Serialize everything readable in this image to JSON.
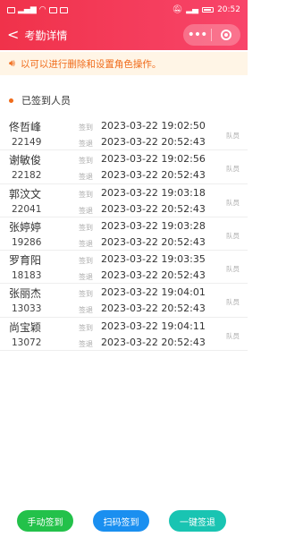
{
  "status_bar": {
    "time": "20:52"
  },
  "navbar": {
    "back_symbol": "<",
    "title": "考勤详情"
  },
  "notice": {
    "icon": "speaker-icon",
    "text": "以可以进行删除和设置角色操作。"
  },
  "section": {
    "title": "已签到人员"
  },
  "labels": {
    "sign_in": "签到",
    "sign_out": "签退"
  },
  "records": [
    {
      "name": "佟哲峰",
      "id": "22149",
      "sign_in": "2023-03-22 19:02:50",
      "sign_out": "2023-03-22 20:52:43",
      "role": "队员"
    },
    {
      "name": "谢敏俊",
      "id": "22182",
      "sign_in": "2023-03-22 19:02:56",
      "sign_out": "2023-03-22 20:52:43",
      "role": "队员"
    },
    {
      "name": "郭汶文",
      "id": "22041",
      "sign_in": "2023-03-22 19:03:18",
      "sign_out": "2023-03-22 20:52:43",
      "role": "队员"
    },
    {
      "name": "张婷婷",
      "id": "19286",
      "sign_in": "2023-03-22 19:03:28",
      "sign_out": "2023-03-22 20:52:43",
      "role": "队员"
    },
    {
      "name": "罗育阳",
      "id": "18183",
      "sign_in": "2023-03-22 19:03:35",
      "sign_out": "2023-03-22 20:52:43",
      "role": "队员"
    },
    {
      "name": "张丽杰",
      "id": "13033",
      "sign_in": "2023-03-22 19:04:01",
      "sign_out": "2023-03-22 20:52:43",
      "role": "队员"
    },
    {
      "name": "尚宝颖",
      "id": "13072",
      "sign_in": "2023-03-22 19:04:11",
      "sign_out": "2023-03-22 20:52:43",
      "role": "队员"
    }
  ],
  "buttons": {
    "manual": "手动签到",
    "scan": "扫码签到",
    "sign_out_all": "一键签退"
  },
  "colors": {
    "header": "#f0324a",
    "accent": "#f06b1a",
    "manual": "#23c14a",
    "scan": "#1a8ff0",
    "sign_out_all": "#19c4b2"
  }
}
